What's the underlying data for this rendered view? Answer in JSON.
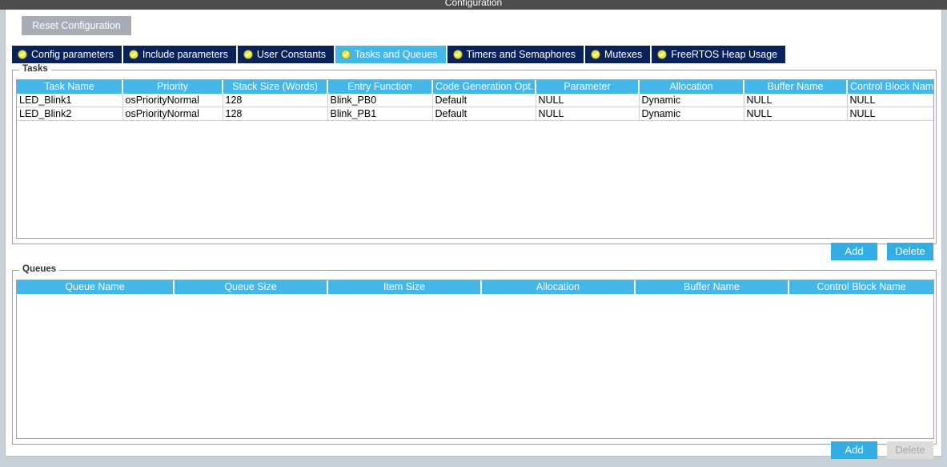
{
  "window": {
    "title": "Configuration"
  },
  "toolbar": {
    "reset_label": "Reset Configuration"
  },
  "tabs": [
    {
      "label": "Config parameters",
      "icon": "check-circle-icon",
      "active": false
    },
    {
      "label": "Include parameters",
      "icon": "check-circle-icon",
      "active": false
    },
    {
      "label": "User Constants",
      "icon": "check-circle-icon",
      "active": false
    },
    {
      "label": "Tasks and Queues",
      "icon": "check-circle-icon",
      "active": true
    },
    {
      "label": "Timers and Semaphores",
      "icon": "check-circle-icon",
      "active": false
    },
    {
      "label": "Mutexes",
      "icon": "check-circle-icon",
      "active": false
    },
    {
      "label": "FreeRTOS Heap Usage",
      "icon": "check-circle-icon",
      "active": false
    }
  ],
  "tasks": {
    "legend": "Tasks",
    "columns": [
      "Task Name",
      "Priority",
      "Stack Size (Words)",
      "Entry Function",
      "Code Generation Opt...",
      "Parameter",
      "Allocation",
      "Buffer Name",
      "Control Block Name"
    ],
    "rows": [
      [
        "LED_Blink1",
        "osPriorityNormal",
        "128",
        "Blink_PB0",
        "Default",
        "NULL",
        "Dynamic",
        "NULL",
        "NULL"
      ],
      [
        "LED_Blink2",
        "osPriorityNormal",
        "128",
        "Blink_PB1",
        "Default",
        "NULL",
        "Dynamic",
        "NULL",
        "NULL"
      ]
    ],
    "add_label": "Add",
    "delete_label": "Delete",
    "delete_enabled": true
  },
  "queues": {
    "legend": "Queues",
    "columns": [
      "Queue Name",
      "Queue Size",
      "Item Size",
      "Allocation",
      "Buffer Name",
      "Control Block Name"
    ],
    "rows": [],
    "add_label": "Add",
    "delete_label": "Delete",
    "delete_enabled": false
  },
  "colors": {
    "accent": "#45b6e8",
    "tab_inactive": "#0b2159",
    "button_blue": "#34aee2",
    "button_disabled": "#dcdcdc",
    "titlebar": "#4d4d4d",
    "window_chrome": "#c8d0d8"
  }
}
